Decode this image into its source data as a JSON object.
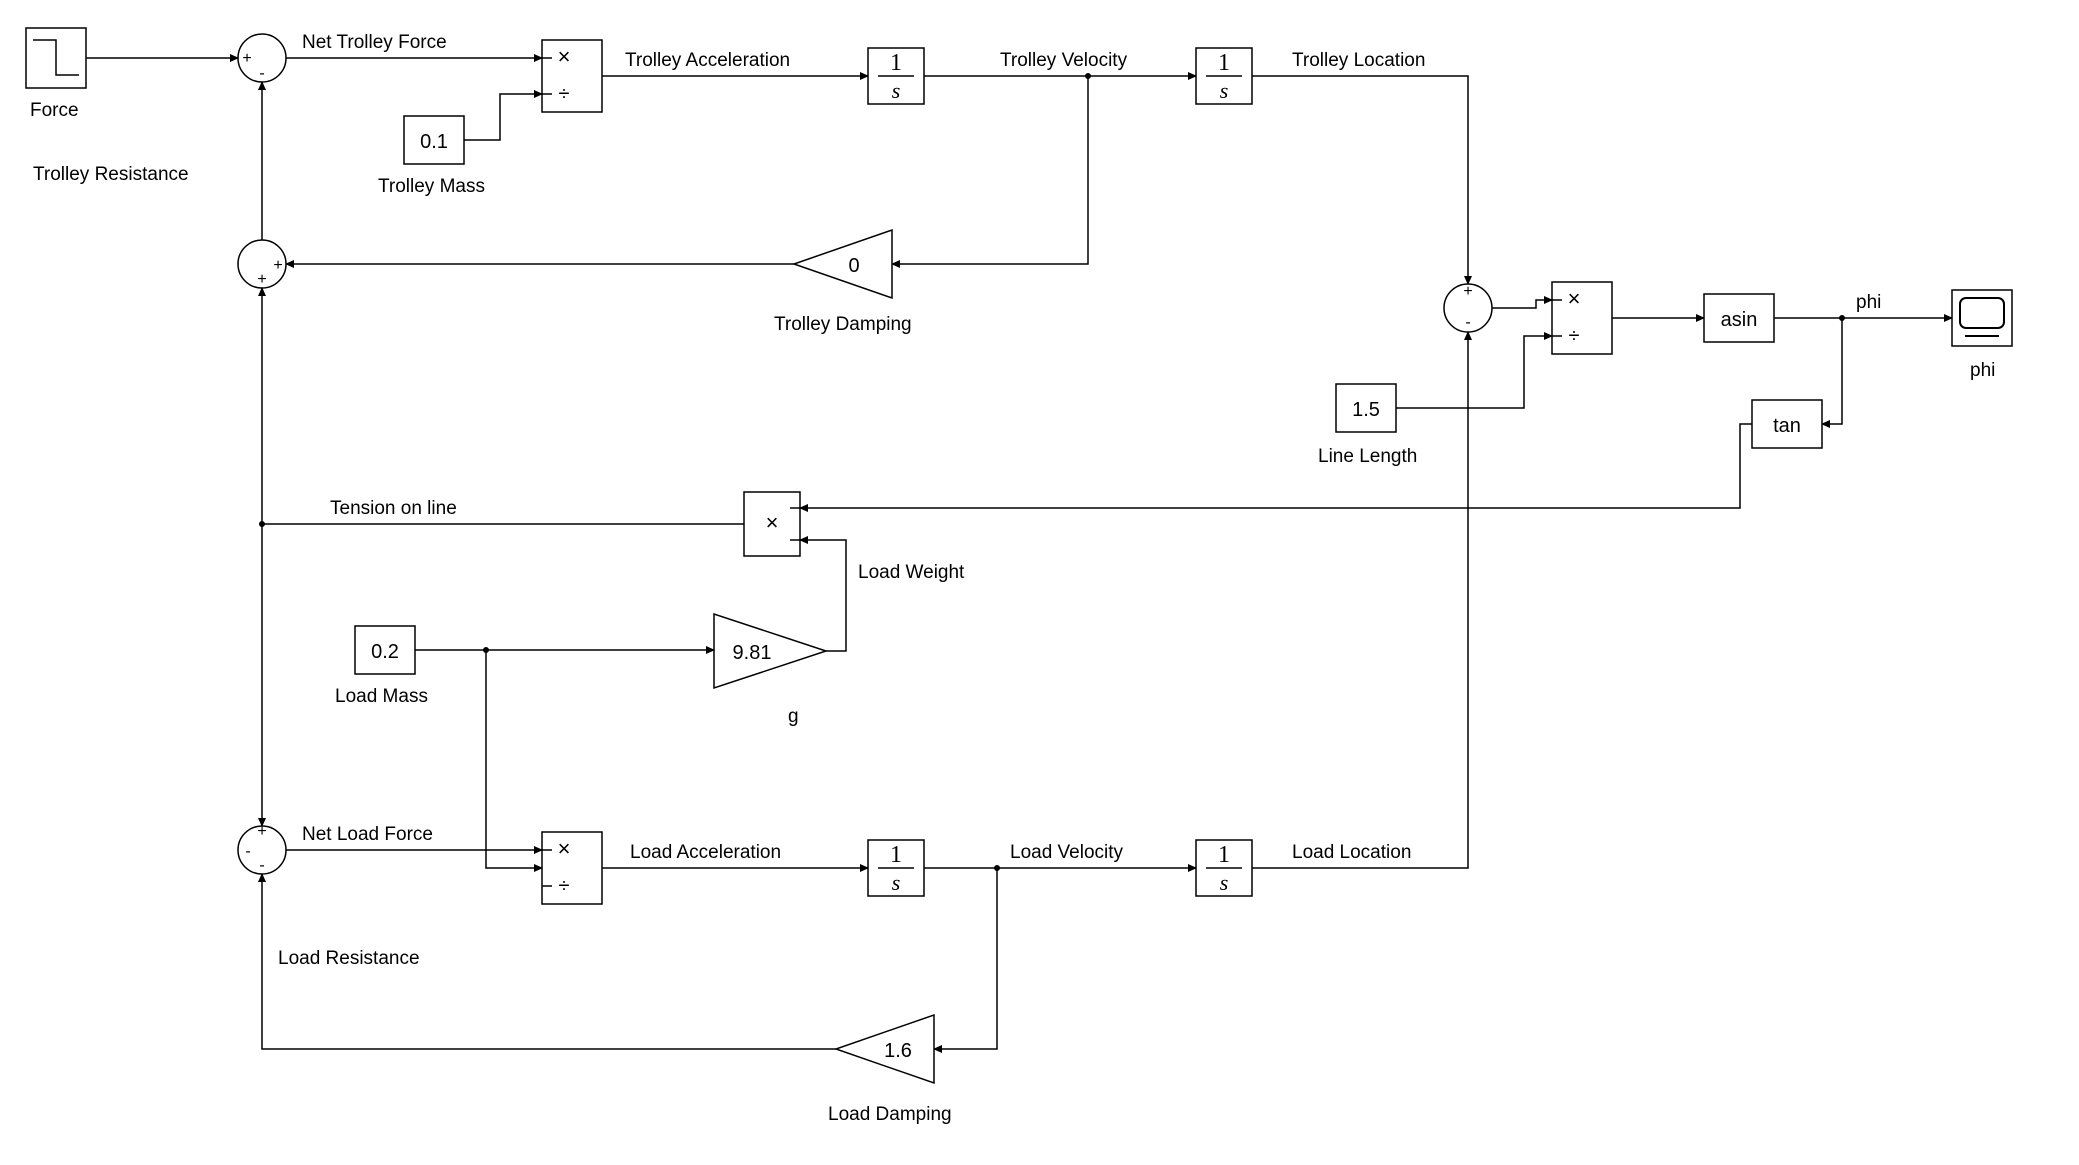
{
  "blocks": {
    "force": {
      "label": "Force"
    },
    "trolley_mass": {
      "label": "Trolley Mass",
      "value": "0.1"
    },
    "trolley_damp": {
      "label": "Trolley Damping",
      "value": "0"
    },
    "load_mass": {
      "label": "Load Mass",
      "value": "0.2"
    },
    "g": {
      "label": "g",
      "value": "9.81"
    },
    "line_length": {
      "label": "Line Length",
      "value": "1.5"
    },
    "load_damp": {
      "label": "Load Damping",
      "value": "1.6"
    },
    "asin": {
      "label": "asin"
    },
    "tan": {
      "label": "tan"
    },
    "phi_scope": {
      "label": "phi"
    }
  },
  "signals": {
    "net_trolley_force": "Net Trolley Force",
    "trolley_accel": "Trolley Acceleration",
    "trolley_vel": "Trolley Velocity",
    "trolley_loc": "Trolley Location",
    "trolley_resist": "Trolley Resistance",
    "tension": "Tension on line",
    "load_weight": "Load Weight",
    "net_load_force": "Net Load Force",
    "load_accel": "Load Acceleration",
    "load_vel": "Load Velocity",
    "load_loc": "Load Location",
    "load_resist": "Load Resistance",
    "phi": "phi"
  },
  "ops": {
    "times": "×",
    "divide": "÷"
  },
  "integrator": {
    "num": "1",
    "den": "s"
  },
  "sum_signs": {
    "sum1_top": {
      "top": "+",
      "bottom": "-"
    },
    "sum2_mid": {
      "top": "+",
      "bottom": "+"
    },
    "sum3_load": {
      "top": "+",
      "bottom": "-",
      "left": "-"
    },
    "sum4_diff": {
      "top": "+",
      "bottom": "-"
    }
  }
}
